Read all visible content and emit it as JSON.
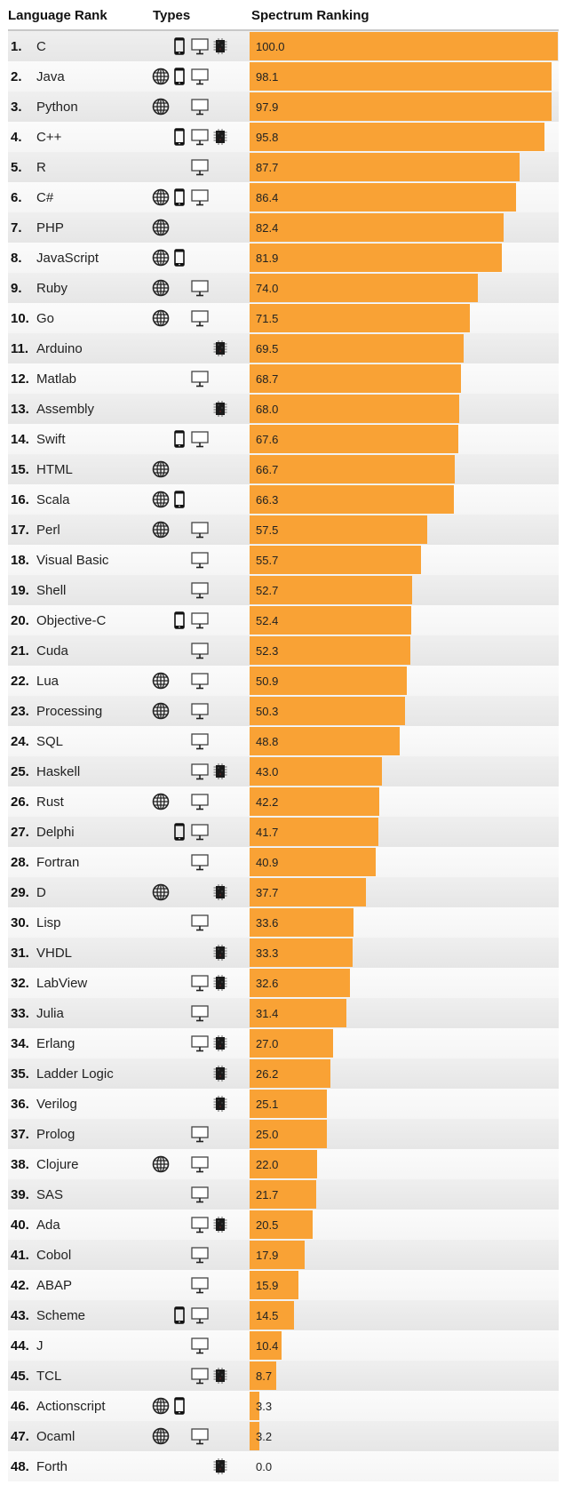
{
  "header": {
    "language_rank": "Language Rank",
    "types": "Types",
    "spectrum_ranking": "Spectrum Ranking"
  },
  "colors": {
    "bar": "#f9a235",
    "header_rule": "#c8c8c8"
  },
  "icons": {
    "web": "globe-icon",
    "mobile": "mobile-phone-icon",
    "desktop": "desktop-monitor-icon",
    "embedded": "chip-icon"
  },
  "chart_data": {
    "type": "bar",
    "orientation": "horizontal",
    "title": "Spectrum Ranking",
    "xlim": [
      0,
      100
    ],
    "grid": false,
    "legend": "none",
    "columns": [
      "Language Rank",
      "Types",
      "Spectrum Ranking"
    ],
    "rows": [
      {
        "rank": "1.",
        "name": "C",
        "types": [
          "mobile",
          "desktop",
          "embedded"
        ],
        "value": 100.0,
        "label": "100.0"
      },
      {
        "rank": "2.",
        "name": "Java",
        "types": [
          "web",
          "mobile",
          "desktop"
        ],
        "value": 98.1,
        "label": "98.1"
      },
      {
        "rank": "3.",
        "name": "Python",
        "types": [
          "web",
          "desktop"
        ],
        "value": 97.9,
        "label": "97.9"
      },
      {
        "rank": "4.",
        "name": "C++",
        "types": [
          "mobile",
          "desktop",
          "embedded"
        ],
        "value": 95.8,
        "label": "95.8"
      },
      {
        "rank": "5.",
        "name": "R",
        "types": [
          "desktop"
        ],
        "value": 87.7,
        "label": "87.7"
      },
      {
        "rank": "6.",
        "name": "C#",
        "types": [
          "web",
          "mobile",
          "desktop"
        ],
        "value": 86.4,
        "label": "86.4"
      },
      {
        "rank": "7.",
        "name": "PHP",
        "types": [
          "web"
        ],
        "value": 82.4,
        "label": "82.4"
      },
      {
        "rank": "8.",
        "name": "JavaScript",
        "types": [
          "web",
          "mobile"
        ],
        "value": 81.9,
        "label": "81.9"
      },
      {
        "rank": "9.",
        "name": "Ruby",
        "types": [
          "web",
          "desktop"
        ],
        "value": 74.0,
        "label": "74.0"
      },
      {
        "rank": "10.",
        "name": "Go",
        "types": [
          "web",
          "desktop"
        ],
        "value": 71.5,
        "label": "71.5"
      },
      {
        "rank": "11.",
        "name": "Arduino",
        "types": [
          "embedded"
        ],
        "value": 69.5,
        "label": "69.5"
      },
      {
        "rank": "12.",
        "name": "Matlab",
        "types": [
          "desktop"
        ],
        "value": 68.7,
        "label": "68.7"
      },
      {
        "rank": "13.",
        "name": "Assembly",
        "types": [
          "embedded"
        ],
        "value": 68.0,
        "label": "68.0"
      },
      {
        "rank": "14.",
        "name": "Swift",
        "types": [
          "mobile",
          "desktop"
        ],
        "value": 67.6,
        "label": "67.6"
      },
      {
        "rank": "15.",
        "name": "HTML",
        "types": [
          "web"
        ],
        "value": 66.7,
        "label": "66.7"
      },
      {
        "rank": "16.",
        "name": "Scala",
        "types": [
          "web",
          "mobile"
        ],
        "value": 66.3,
        "label": "66.3"
      },
      {
        "rank": "17.",
        "name": "Perl",
        "types": [
          "web",
          "desktop"
        ],
        "value": 57.5,
        "label": "57.5"
      },
      {
        "rank": "18.",
        "name": "Visual Basic",
        "types": [
          "desktop"
        ],
        "value": 55.7,
        "label": "55.7"
      },
      {
        "rank": "19.",
        "name": "Shell",
        "types": [
          "desktop"
        ],
        "value": 52.7,
        "label": "52.7"
      },
      {
        "rank": "20.",
        "name": "Objective-C",
        "types": [
          "mobile",
          "desktop"
        ],
        "value": 52.4,
        "label": "52.4"
      },
      {
        "rank": "21.",
        "name": "Cuda",
        "types": [
          "desktop"
        ],
        "value": 52.3,
        "label": "52.3"
      },
      {
        "rank": "22.",
        "name": "Lua",
        "types": [
          "web",
          "desktop"
        ],
        "value": 50.9,
        "label": "50.9"
      },
      {
        "rank": "23.",
        "name": "Processing",
        "types": [
          "web",
          "desktop"
        ],
        "value": 50.3,
        "label": "50.3"
      },
      {
        "rank": "24.",
        "name": "SQL",
        "types": [
          "desktop"
        ],
        "value": 48.8,
        "label": "48.8"
      },
      {
        "rank": "25.",
        "name": "Haskell",
        "types": [
          "desktop",
          "embedded"
        ],
        "value": 43.0,
        "label": "43.0"
      },
      {
        "rank": "26.",
        "name": "Rust",
        "types": [
          "web",
          "desktop"
        ],
        "value": 42.2,
        "label": "42.2"
      },
      {
        "rank": "27.",
        "name": "Delphi",
        "types": [
          "mobile",
          "desktop"
        ],
        "value": 41.7,
        "label": "41.7"
      },
      {
        "rank": "28.",
        "name": "Fortran",
        "types": [
          "desktop"
        ],
        "value": 40.9,
        "label": "40.9"
      },
      {
        "rank": "29.",
        "name": "D",
        "types": [
          "web",
          "embedded"
        ],
        "value": 37.7,
        "label": "37.7"
      },
      {
        "rank": "30.",
        "name": "Lisp",
        "types": [
          "desktop"
        ],
        "value": 33.6,
        "label": "33.6"
      },
      {
        "rank": "31.",
        "name": "VHDL",
        "types": [
          "embedded"
        ],
        "value": 33.3,
        "label": "33.3"
      },
      {
        "rank": "32.",
        "name": "LabView",
        "types": [
          "desktop",
          "embedded"
        ],
        "value": 32.6,
        "label": "32.6"
      },
      {
        "rank": "33.",
        "name": "Julia",
        "types": [
          "desktop"
        ],
        "value": 31.4,
        "label": "31.4"
      },
      {
        "rank": "34.",
        "name": "Erlang",
        "types": [
          "desktop",
          "embedded"
        ],
        "value": 27.0,
        "label": "27.0"
      },
      {
        "rank": "35.",
        "name": "Ladder Logic",
        "types": [
          "embedded"
        ],
        "value": 26.2,
        "label": "26.2"
      },
      {
        "rank": "36.",
        "name": "Verilog",
        "types": [
          "embedded"
        ],
        "value": 25.1,
        "label": "25.1"
      },
      {
        "rank": "37.",
        "name": "Prolog",
        "types": [
          "desktop"
        ],
        "value": 25.0,
        "label": "25.0"
      },
      {
        "rank": "38.",
        "name": "Clojure",
        "types": [
          "web",
          "desktop"
        ],
        "value": 22.0,
        "label": "22.0"
      },
      {
        "rank": "39.",
        "name": "SAS",
        "types": [
          "desktop"
        ],
        "value": 21.7,
        "label": "21.7"
      },
      {
        "rank": "40.",
        "name": "Ada",
        "types": [
          "desktop",
          "embedded"
        ],
        "value": 20.5,
        "label": "20.5"
      },
      {
        "rank": "41.",
        "name": "Cobol",
        "types": [
          "desktop"
        ],
        "value": 17.9,
        "label": "17.9"
      },
      {
        "rank": "42.",
        "name": "ABAP",
        "types": [
          "desktop"
        ],
        "value": 15.9,
        "label": "15.9"
      },
      {
        "rank": "43.",
        "name": "Scheme",
        "types": [
          "mobile",
          "desktop"
        ],
        "value": 14.5,
        "label": "14.5"
      },
      {
        "rank": "44.",
        "name": "J",
        "types": [
          "desktop"
        ],
        "value": 10.4,
        "label": "10.4"
      },
      {
        "rank": "45.",
        "name": "TCL",
        "types": [
          "desktop",
          "embedded"
        ],
        "value": 8.7,
        "label": "8.7"
      },
      {
        "rank": "46.",
        "name": "Actionscript",
        "types": [
          "web",
          "mobile"
        ],
        "value": 3.3,
        "label": "3.3"
      },
      {
        "rank": "47.",
        "name": "Ocaml",
        "types": [
          "web",
          "desktop"
        ],
        "value": 3.2,
        "label": "3.2"
      },
      {
        "rank": "48.",
        "name": "Forth",
        "types": [
          "embedded"
        ],
        "value": 0.0,
        "label": "0.0"
      }
    ]
  }
}
